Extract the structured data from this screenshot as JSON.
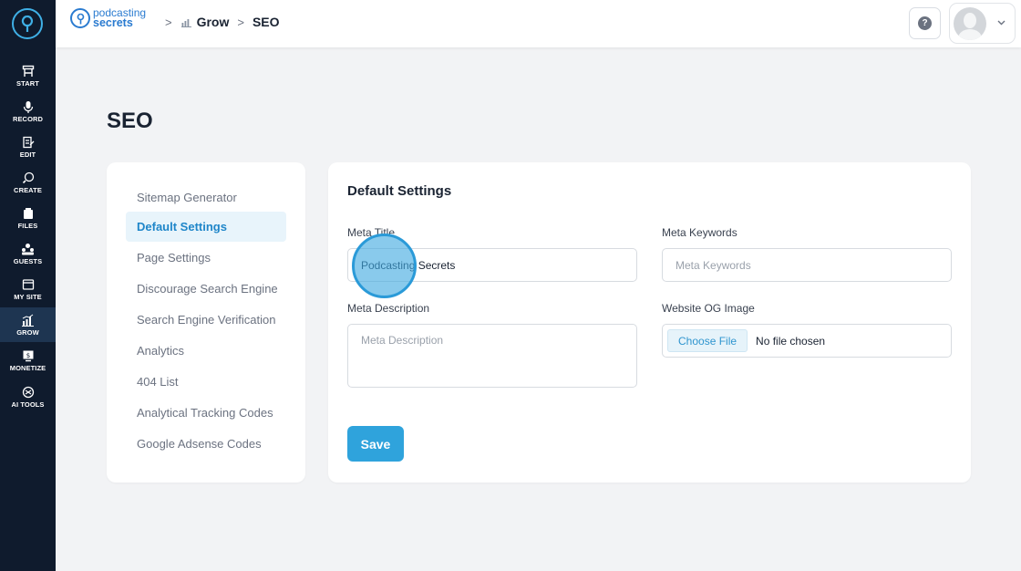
{
  "rail": {
    "items": [
      {
        "label": "START",
        "icon": "start-icon"
      },
      {
        "label": "RECORD",
        "icon": "microphone-icon"
      },
      {
        "label": "EDIT",
        "icon": "edit-icon"
      },
      {
        "label": "CREATE",
        "icon": "create-icon"
      },
      {
        "label": "FILES",
        "icon": "files-icon"
      },
      {
        "label": "GUESTS",
        "icon": "guests-icon"
      },
      {
        "label": "MY SITE",
        "icon": "website-icon"
      },
      {
        "label": "GROW",
        "icon": "bar-chart-icon"
      },
      {
        "label": "MONETIZE",
        "icon": "monetize-icon"
      },
      {
        "label": "AI TOOLS",
        "icon": "ai-tools-icon"
      }
    ],
    "active": "GROW"
  },
  "header": {
    "brand_line1": "podcasting",
    "brand_line2": "secrets",
    "breadcrumb": {
      "sep": ">",
      "grow": "Grow",
      "seo": "SEO"
    },
    "help_symbol": "?"
  },
  "page": {
    "title": "SEO"
  },
  "seo_nav": {
    "items": [
      {
        "label": "Sitemap Generator"
      },
      {
        "label": "Default Settings"
      },
      {
        "label": "Page Settings"
      },
      {
        "label": "Discourage Search Engine"
      },
      {
        "label": "Search Engine Verification"
      },
      {
        "label": "Analytics"
      },
      {
        "label": "404 List"
      },
      {
        "label": "Analytical Tracking Codes"
      },
      {
        "label": "Google Adsense Codes"
      }
    ],
    "active": "Default Settings"
  },
  "form": {
    "title": "Default Settings",
    "meta_title": {
      "label": "Meta Title",
      "value": "Podcasting Secrets"
    },
    "meta_keywords": {
      "label": "Meta Keywords",
      "placeholder": "Meta Keywords"
    },
    "meta_description": {
      "label": "Meta Description",
      "placeholder": "Meta Description"
    },
    "og_image": {
      "label": "Website OG Image",
      "button": "Choose File",
      "status": "No file chosen"
    },
    "save_label": "Save"
  },
  "colors": {
    "rail_bg": "#0f1b2d",
    "accent": "#2fa3dc",
    "brand": "#2a7bd0"
  }
}
